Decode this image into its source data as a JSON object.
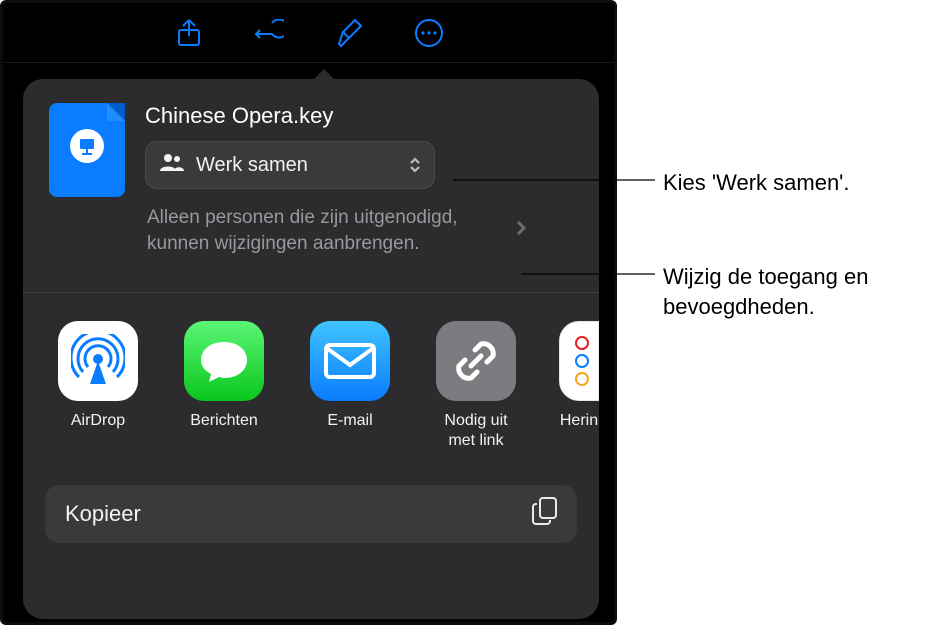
{
  "toolbar": {
    "share": "share-icon",
    "undo": "undo-icon",
    "brush": "brush-icon",
    "more": "more-icon"
  },
  "file": {
    "title": "Chinese Opera.key"
  },
  "collaborate": {
    "label": "Werk samen"
  },
  "access": {
    "text": "Alleen personen die zijn uitgenodigd, kunnen wijzigingen aanbrengen."
  },
  "apps": {
    "airdrop": "AirDrop",
    "messages": "Berichten",
    "mail": "E-mail",
    "invite_link": "Nodig uit\nmet link",
    "reminders_partial": "Herin"
  },
  "actions": {
    "copy": "Kopieer"
  },
  "annotations": {
    "choose_collab": "Kies 'Werk samen'.",
    "change_access": "Wijzig de toegang en bevoegdheden."
  }
}
